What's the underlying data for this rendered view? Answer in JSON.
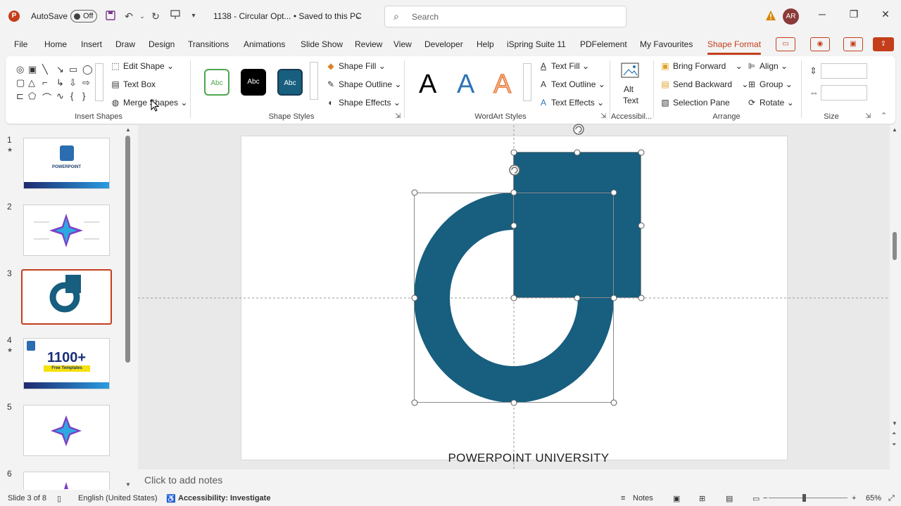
{
  "titlebar": {
    "app_logo": "P",
    "autosave_label": "AutoSave",
    "autosave_state": "Off",
    "doc_title": "1138 - Circular Opt... • Saved to this PC",
    "search_placeholder": "Search",
    "user_initials": "AR"
  },
  "tabs": [
    "File",
    "Home",
    "Insert",
    "Draw",
    "Design",
    "Transitions",
    "Animations",
    "Slide Show",
    "Review",
    "View",
    "Developer",
    "Help",
    "iSpring Suite 11",
    "PDFelement",
    "My Favourites",
    "Shape Format"
  ],
  "active_tab": "Shape Format",
  "ribbon": {
    "insert_shapes": {
      "edit_shape": "Edit Shape",
      "text_box": "Text Box",
      "merge_shapes": "Merge Shapes",
      "label": "Insert Shapes"
    },
    "shape_styles": {
      "swatches": [
        "Abc",
        "Abc",
        "Abc"
      ],
      "shape_fill": "Shape Fill",
      "shape_outline": "Shape Outline",
      "shape_effects": "Shape Effects",
      "label": "Shape Styles"
    },
    "wordart": {
      "letters": [
        "A",
        "A",
        "A"
      ],
      "text_fill": "Text Fill",
      "text_outline": "Text Outline",
      "text_effects": "Text Effects",
      "label": "WordArt Styles"
    },
    "accessibility": {
      "alt_text_line1": "Alt",
      "alt_text_line2": "Text",
      "label": "Accessibil..."
    },
    "arrange": {
      "bring_forward": "Bring Forward",
      "send_backward": "Send Backward",
      "selection_pane": "Selection Pane",
      "align": "Align",
      "group": "Group",
      "rotate": "Rotate",
      "label": "Arrange"
    },
    "size": {
      "label": "Size"
    }
  },
  "slides": [
    {
      "num": "1",
      "star": true
    },
    {
      "num": "2",
      "star": false
    },
    {
      "num": "3",
      "star": false,
      "selected": true
    },
    {
      "num": "4",
      "star": true
    },
    {
      "num": "5",
      "star": false
    },
    {
      "num": "6",
      "star": false
    }
  ],
  "thumb_texts": {
    "t1_title": "POWERPOINT",
    "t4_big": "1100+",
    "t4_sub": "Free Templates"
  },
  "slide": {
    "footer": "POWERPOINT UNIVERSITY",
    "shape_color": "#175e7f"
  },
  "notes_placeholder": "Click to add notes",
  "status": {
    "slide_info": "Slide 3 of 8",
    "language": "English (United States)",
    "accessibility": "Accessibility: Investigate",
    "notes": "Notes",
    "zoom": "65%"
  },
  "colors": {
    "accent": "#c43e1c",
    "shape": "#175e7f"
  }
}
